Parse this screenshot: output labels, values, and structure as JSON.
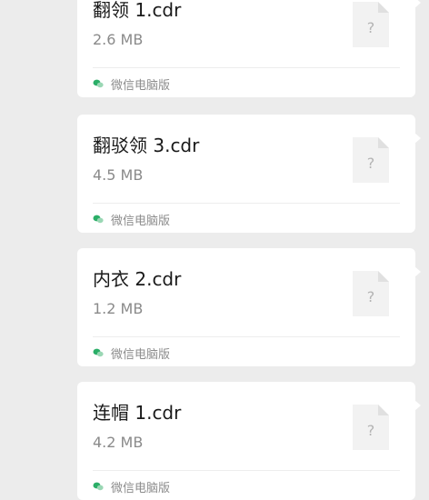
{
  "messages": [
    {
      "file_name": "翻领 1.cdr",
      "file_size": "2.6 MB",
      "file_icon": "unknown-file-icon",
      "source_icon": "wechat-icon",
      "source_label": "微信电脑版"
    },
    {
      "file_name": "翻驳领 3.cdr",
      "file_size": "4.5 MB",
      "file_icon": "unknown-file-icon",
      "source_icon": "wechat-icon",
      "source_label": "微信电脑版"
    },
    {
      "file_name": "内衣 2.cdr",
      "file_size": "1.2 MB",
      "file_icon": "unknown-file-icon",
      "source_icon": "wechat-icon",
      "source_label": "微信电脑版"
    },
    {
      "file_name": "连帽 1.cdr",
      "file_size": "4.2 MB",
      "file_icon": "unknown-file-icon",
      "source_icon": "wechat-icon",
      "source_label": "微信电脑版"
    }
  ],
  "colors": {
    "background": "#ececec",
    "card": "#ffffff",
    "wechat_green": "#2aae67"
  }
}
